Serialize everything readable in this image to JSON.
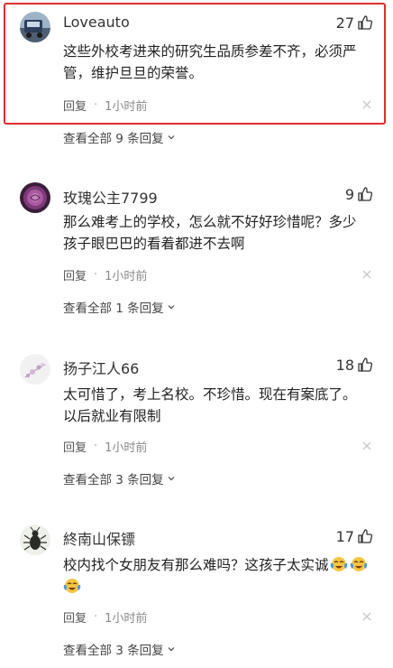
{
  "comments": [
    {
      "username": "Loveauto",
      "likes": "27",
      "text_lines": [
        "这些外校考进来的研究生品质参差不齐，必须严",
        "管，维护旦旦的荣誉。"
      ],
      "reply_label": "回复",
      "separator": "·",
      "time": "1小时前",
      "view_all": "查看全部 9 条回复",
      "avatar_icon": "truck-avatar",
      "highlighted": true
    },
    {
      "username": "玫瑰公主7799",
      "likes": "9",
      "text_lines": [
        "那么难考上的学校，怎么就不好好珍惜呢？多少",
        "孩子眼巴巴的看着都进不去啊"
      ],
      "reply_label": "回复",
      "separator": "·",
      "time": "1小时前",
      "view_all": "查看全部 1 条回复",
      "avatar_icon": "rose-avatar"
    },
    {
      "username": "扬子江人66",
      "likes": "18",
      "text_lines": [
        "太可惜了，考上名校。不珍惜。现在有案底了。",
        "以后就业有限制"
      ],
      "reply_label": "回复",
      "separator": "·",
      "time": "1小时前",
      "view_all": "查看全部 3 条回复",
      "avatar_icon": "flower-avatar"
    },
    {
      "username": "終南山保镖",
      "likes": "17",
      "text_lines": [
        "校内找个女朋友有那么难吗？这孩子太实诚"
      ],
      "emoji_icon": "crying-laughing-emoji",
      "reply_label": "回复",
      "separator": "·",
      "time": "1小时前",
      "view_all": "查看全部 3 条回复",
      "avatar_icon": "beetle-avatar"
    }
  ],
  "colors": {
    "highlight_border": "#e02b2b",
    "meta_text": "#888888",
    "body_text": "#222222"
  }
}
